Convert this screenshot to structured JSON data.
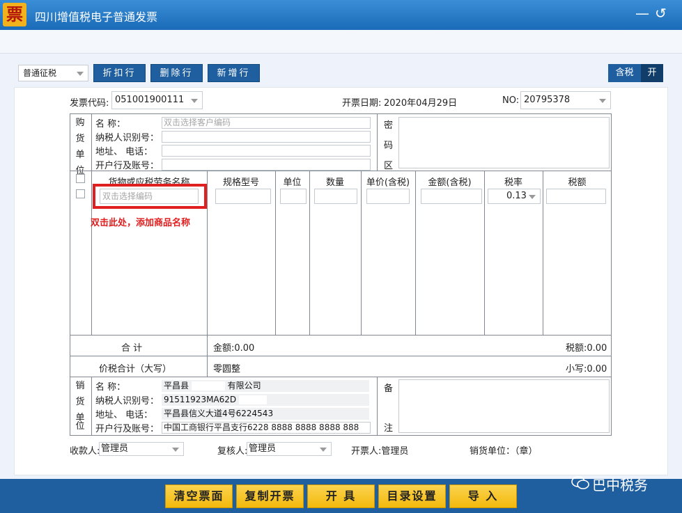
{
  "window": {
    "title": "四川增值税电子普通发票",
    "logo_text": "票",
    "minimize_glyph": "—",
    "back_glyph": "↺"
  },
  "toolbar": {
    "tax_type": "普通征税",
    "discount_row": "折扣行",
    "delete_row": "删除行",
    "add_row": "新增行",
    "tax_incl_label": "含税",
    "tax_incl_state": "开"
  },
  "header": {
    "code_label": "发票代码:",
    "code_value": "051001900111",
    "date_label": "开票日期:",
    "date_value": "2020年04月29日",
    "no_label": "NO:",
    "no_value": "20795378"
  },
  "buyer": {
    "side_label": [
      "购",
      "货",
      "单",
      "位"
    ],
    "name_label": "名          称：",
    "name_placeholder": "双击选择客户编码",
    "taxid_label": "纳税人识别号：",
    "addr_label": "地址、   电话：",
    "bank_label": "开户行及账号："
  },
  "password_area": {
    "label": [
      "密",
      "码",
      "区"
    ]
  },
  "items": {
    "columns": {
      "name": "货物或应税劳务名称",
      "spec": "规格型号",
      "unit": "单位",
      "qty": "数量",
      "price": "单价(含税)",
      "amount": "金额(含税)",
      "rate": "税率",
      "tax": "税额"
    },
    "name_placeholder": "双击选择编码",
    "rate_value": "0.13",
    "annotation": "双击此处，添加商品名称"
  },
  "totals": {
    "sum_label": "合          计",
    "amount": "金额:0.00",
    "tax": "税额:0.00",
    "total_words_label": "价税合计（大写）",
    "total_words": "零圆整",
    "total_small": "小写:0.00"
  },
  "seller": {
    "side_label": [
      "销",
      "货",
      "单",
      "位"
    ],
    "name_label": "名          称：",
    "name_value_a": "平昌县",
    "name_value_b": "有限公司",
    "taxid_label": "纳税人识别号：",
    "taxid_value": "91511923MA62D",
    "addr_label": "地址、   电话：",
    "addr_value": "平昌县信义大道4号6224543",
    "bank_label": "开户行及账号：",
    "bank_value": "中国工商银行平昌支行6228 8888 8888 8888 888"
  },
  "remarks": {
    "label": [
      "备",
      "注"
    ]
  },
  "footer": {
    "payee_label": "收款人:",
    "payee_value": "管理员",
    "reviewer_label": "复核人:",
    "reviewer_value": "管理员",
    "drawer": "开票人:管理员",
    "seller_seal": "销货单位：（章）"
  },
  "actions": {
    "clear": "清空票面",
    "copy": "复制开票",
    "issue": "开 具",
    "catalog": "目录设置",
    "import": "导 入"
  },
  "watermark": "巴中税务",
  "colors": {
    "title_blue": "#1b6bb8",
    "action_yellow": "#f3b90c",
    "annotation_red": "#e02020"
  }
}
